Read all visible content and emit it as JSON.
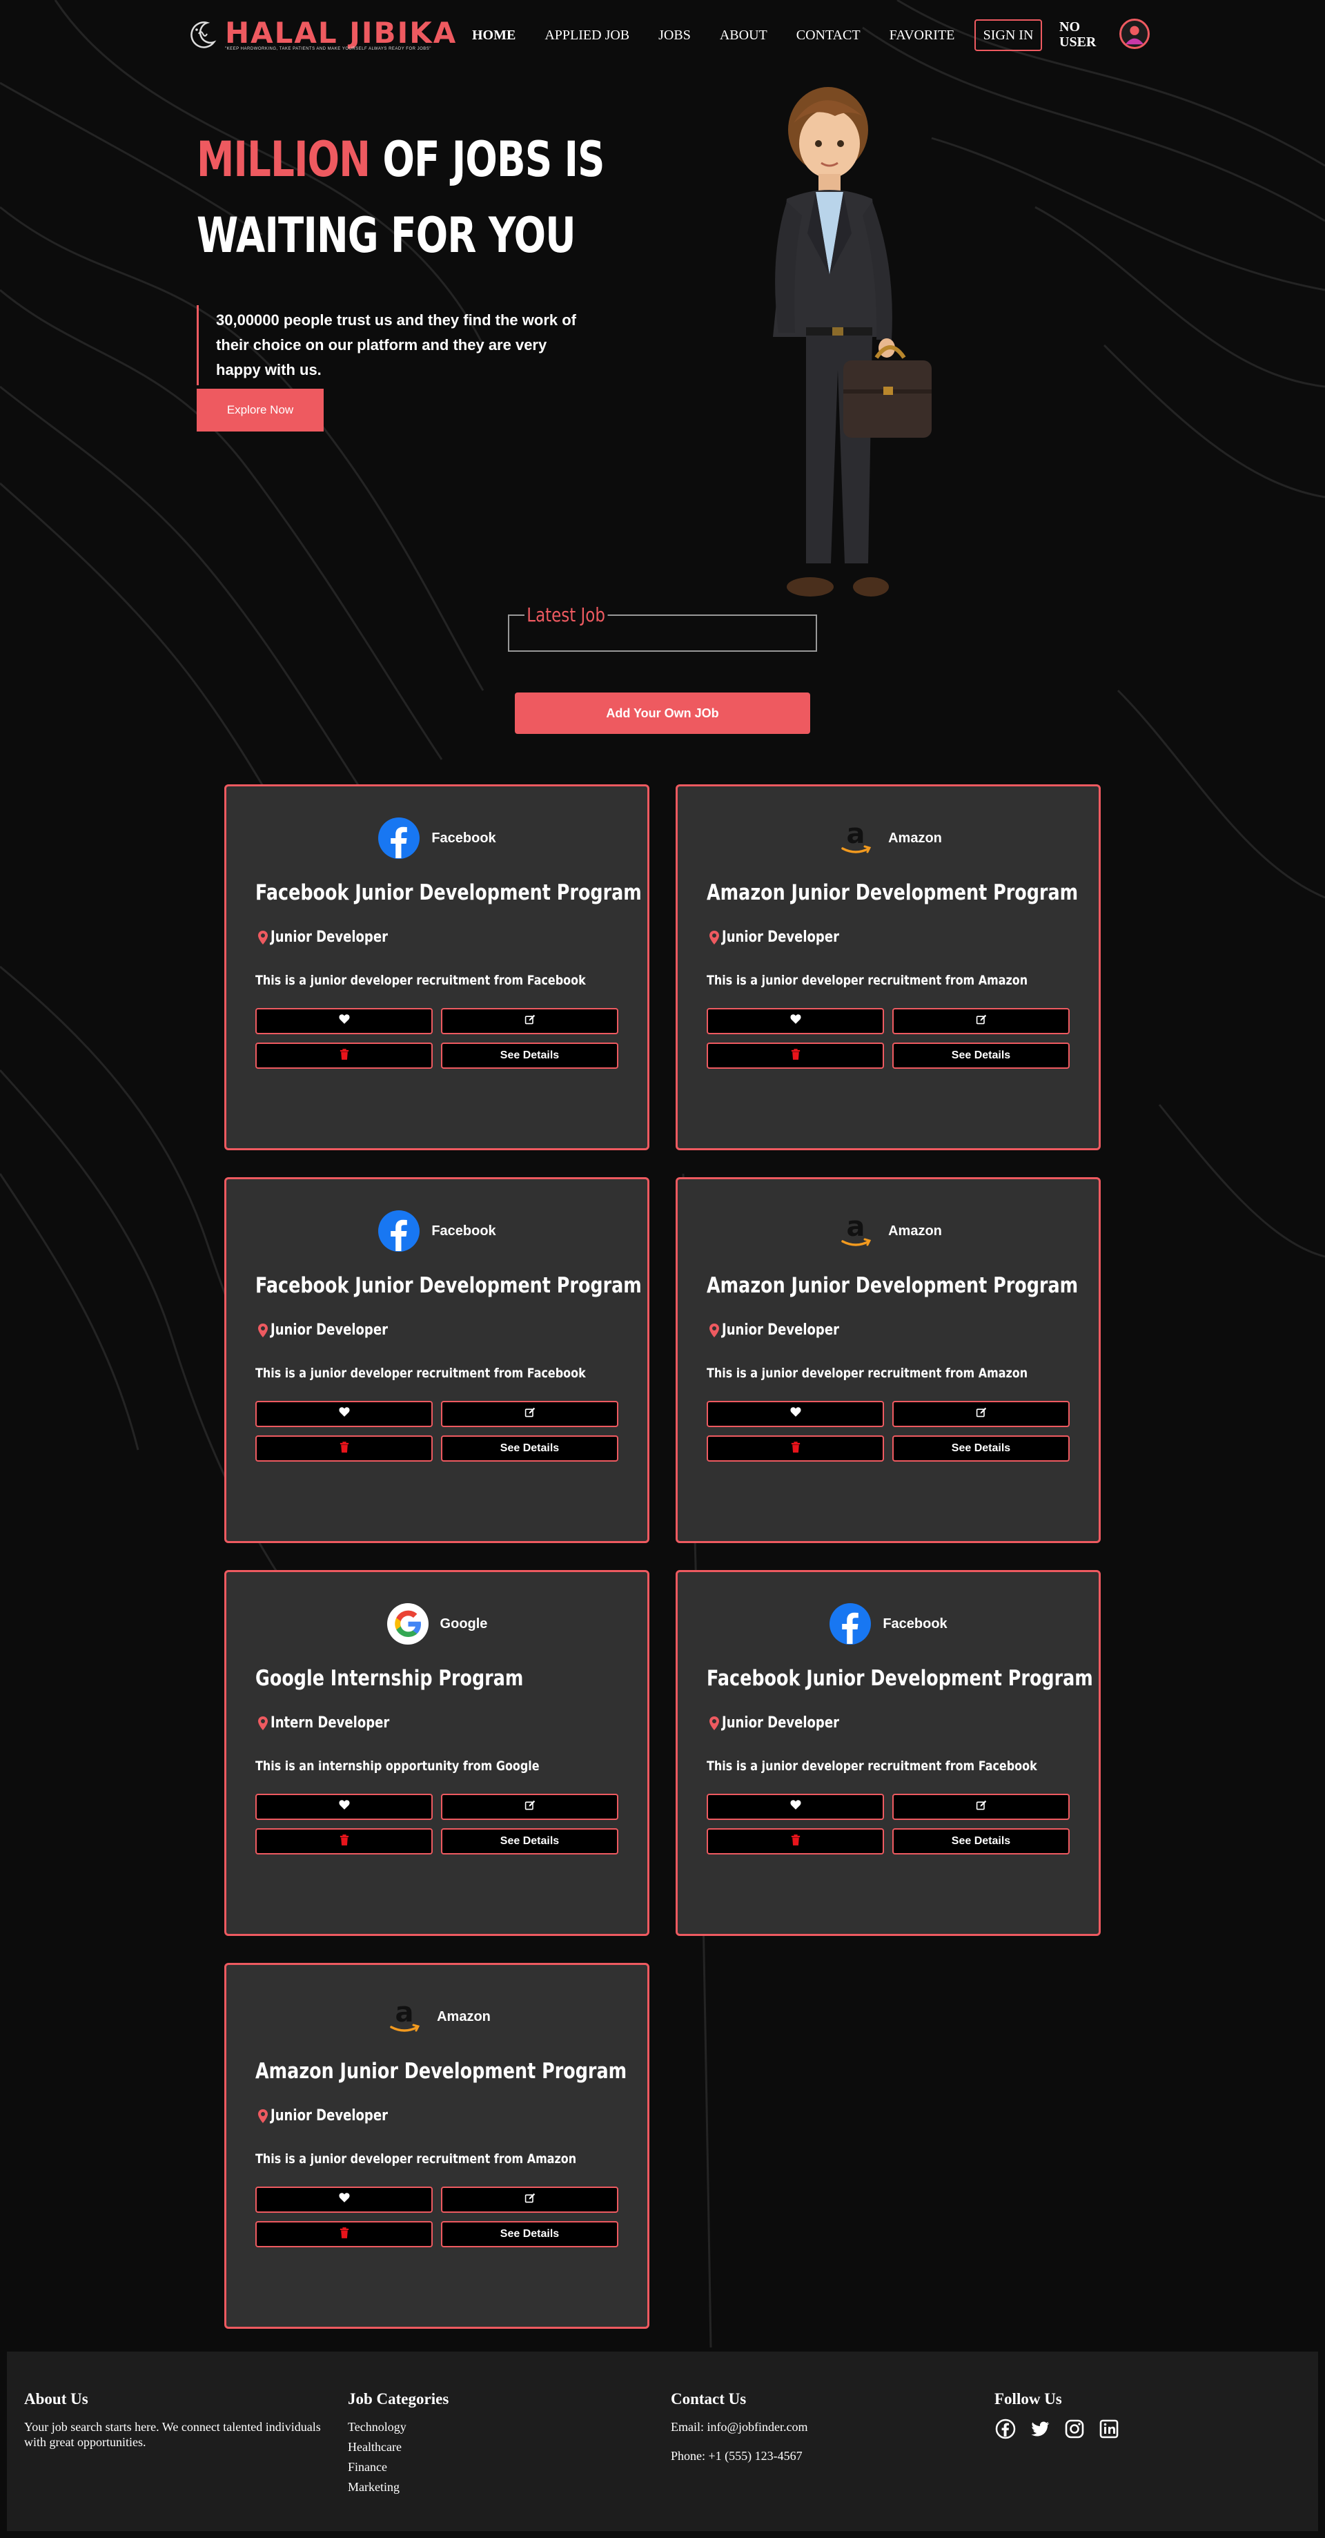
{
  "brand": {
    "name": "HALAL JIBIKA",
    "tagline": "\"KEEP HARDWORKING, TAKE PATIENTS AND MAKE YOURSELF ALWAYS READY FOR JOBS\""
  },
  "nav": {
    "items": [
      "HOME",
      "APPLIED JOB",
      "JOBS",
      "ABOUT",
      "CONTACT",
      "FAVORITE"
    ],
    "signin": "SIGN IN",
    "user": "NO USER"
  },
  "hero": {
    "title_accent": "MILLION",
    "title_rest_1": "OF JOBS IS",
    "title_line_2": "WAITING FOR YOU",
    "description": "30,00000 people trust us and they find the work of their choice on our platform and they are very happy with us.",
    "cta": "Explore Now"
  },
  "latest": {
    "label": "Latest Job",
    "add_button": "Add Your Own JOb"
  },
  "jobs": [
    {
      "company": "Facebook",
      "logo": "facebook-logo",
      "title": "Facebook Junior Development Program",
      "role": "Junior Developer",
      "description": "This is a junior developer recruitment from Facebook",
      "details": "See Details"
    },
    {
      "company": "Amazon",
      "logo": "amazon-logo",
      "title": "Amazon Junior Development Program",
      "role": "Junior Developer",
      "description": "This is a junior developer recruitment from Amazon",
      "details": "See Details"
    },
    {
      "company": "Facebook",
      "logo": "facebook-logo",
      "title": "Facebook Junior Development Program",
      "role": "Junior Developer",
      "description": "This is a junior developer recruitment from Facebook",
      "details": "See Details"
    },
    {
      "company": "Amazon",
      "logo": "amazon-logo",
      "title": "Amazon Junior Development Program",
      "role": "Junior Developer",
      "description": "This is a junior developer recruitment from Amazon",
      "details": "See Details"
    },
    {
      "company": "Google",
      "logo": "google-logo",
      "title": "Google Internship Program",
      "role": "Intern Developer",
      "description": "This is an internship opportunity from Google",
      "details": "See Details"
    },
    {
      "company": "Facebook",
      "logo": "facebook-logo",
      "title": "Facebook Junior Development Program",
      "role": "Junior Developer",
      "description": "This is a junior developer recruitment from Facebook",
      "details": "See Details"
    },
    {
      "company": "Amazon",
      "logo": "amazon-logo",
      "title": "Amazon Junior Development Program",
      "role": "Junior Developer",
      "description": "This is a junior developer recruitment from Amazon",
      "details": "See Details"
    }
  ],
  "footer": {
    "about": {
      "heading": "About Us",
      "text": "Your job search starts here. We connect talented individuals with great opportunities."
    },
    "categories": {
      "heading": "Job Categories",
      "items": [
        "Technology",
        "Healthcare",
        "Finance",
        "Marketing"
      ]
    },
    "contact": {
      "heading": "Contact Us",
      "email": "Email: info@jobfinder.com",
      "phone": "Phone: +1 (555) 123-4567"
    },
    "follow": {
      "heading": "Follow Us",
      "icons": [
        "facebook-icon",
        "twitter-icon",
        "instagram-icon",
        "linkedin-icon"
      ]
    }
  },
  "colors": {
    "accent": "#ee5a60",
    "background": "#0c0c0c",
    "card": "#313131",
    "footer": "#1d1d1d"
  }
}
